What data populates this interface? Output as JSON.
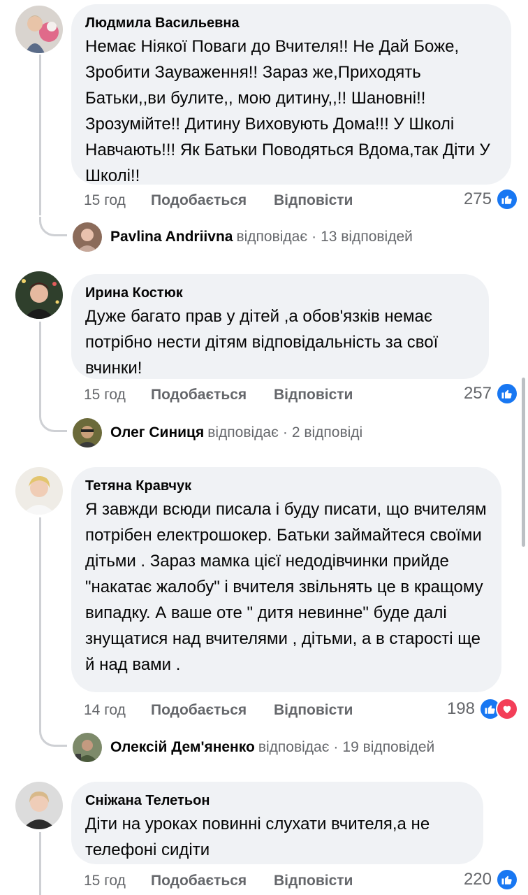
{
  "ui": {
    "like_label": "Подобається",
    "reply_label": "Відповісти",
    "replies_verb": "відповідає",
    "colors": {
      "accent": "#1877f2",
      "heart": "#f33e58",
      "bubble": "#f0f2f5",
      "meta": "#65676b"
    }
  },
  "comments": [
    {
      "author": "Людмила Васильевна",
      "text": "Немає Ніякої Поваги до Вчителя!! Не Дай Боже, Зробити Зауваження!! Зараз же,Приходять Батьки,,ви булите,, мою дитину,,!! Шановні!! Зрозумійте!! Дитину Виховують Дома!!! У Школі Навчають!!! Як Батьки Поводяться Вдома,так Діти У Школі!!",
      "time": "15 год",
      "reactions_count": "275",
      "reactions": [
        "like-icon"
      ],
      "reply_author": "Pavlina Andriivna",
      "reply_count_text": "13 відповідей"
    },
    {
      "author": "Ирина Костюк",
      "text": "Дуже багато прав у дітей ,а обов'язків немає потрібно нести дітям відповідальність за свої вчинки!",
      "time": "15 год",
      "reactions_count": "257",
      "reactions": [
        "like-icon"
      ],
      "reply_author": "Олег Синиця",
      "reply_count_text": "2 відповіді"
    },
    {
      "author": "Тетяна Кравчук",
      "text": "Я завжди всюди писала і буду писати, що вчителям потрібен електрошокер. Батьки займайтеся своїми дітьми . Зараз мамка цієї недодівчинки прийде \"накатає жалобу\" і вчителя звільнять це в кращому випадку. А ваше оте \" дитя невинне\" буде далі знущатися над вчителями , дітьми, а в старості ще й над вами .",
      "time": "14 год",
      "reactions_count": "198",
      "reactions": [
        "like-icon",
        "heart-icon"
      ],
      "reply_author": "Олексій Дем'яненко",
      "reply_count_text": "19 відповідей"
    },
    {
      "author": "Сніжана Телетьон",
      "text": "Діти на уроках повинні слухати вчителя,а не телефоні сидіти",
      "time": "15 год",
      "reactions_count": "220",
      "reactions": [
        "like-icon"
      ]
    }
  ]
}
